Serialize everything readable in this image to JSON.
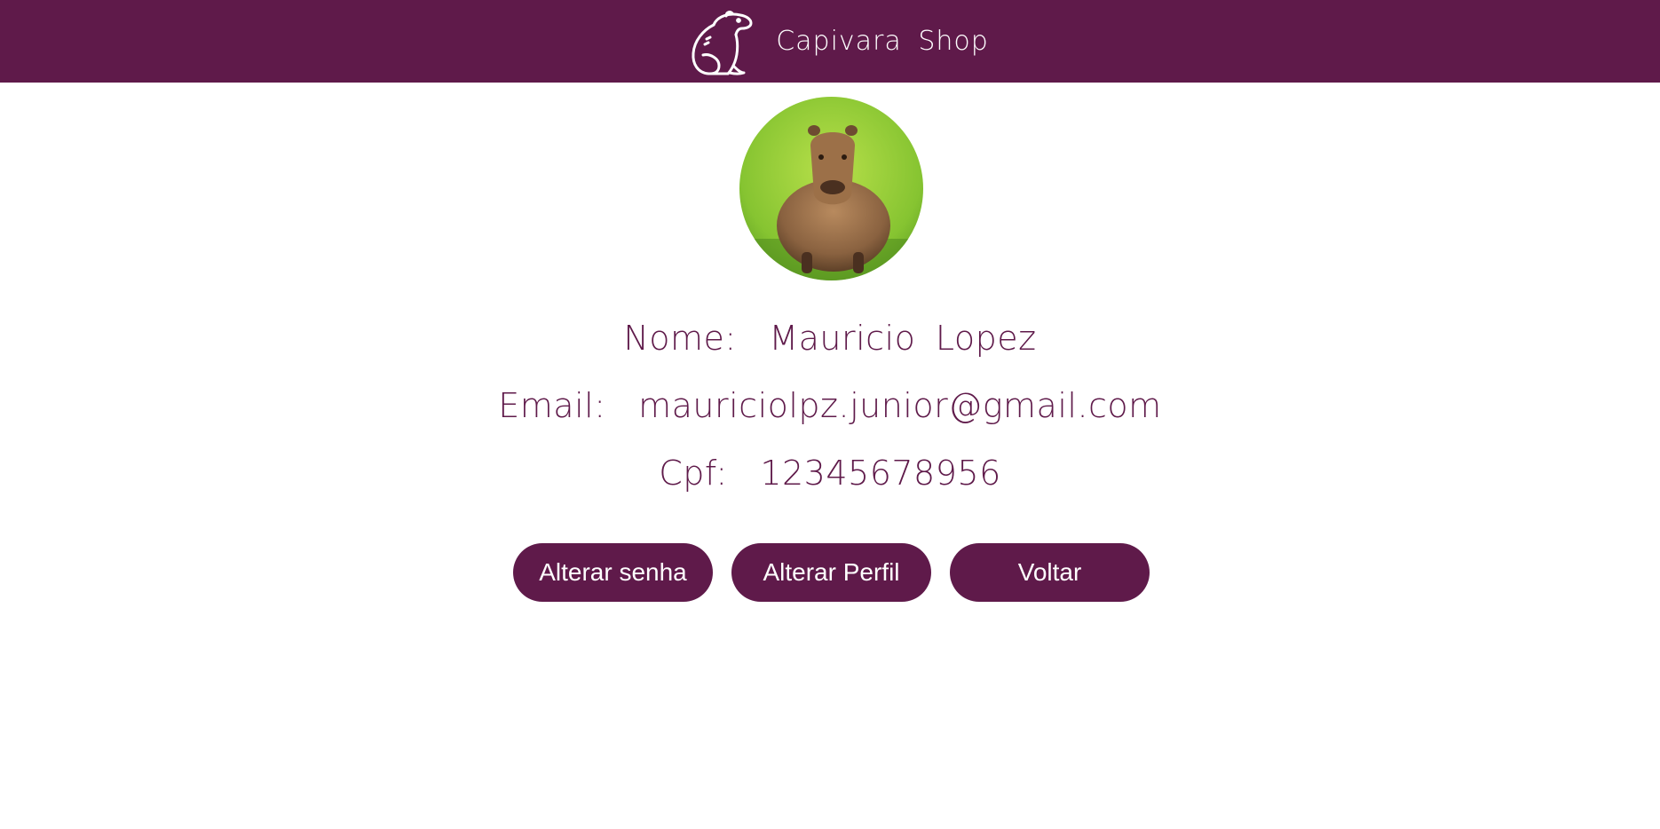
{
  "header": {
    "brand_name": "Capivara Shop",
    "logo_icon": "capybara-outline-icon",
    "background_color": "#5f1a4a"
  },
  "profile": {
    "avatar_icon": "capybara-photo",
    "name_label": "Nome:",
    "name_value": "Mauricio Lopez",
    "email_label": "Email:",
    "email_value": "mauriciolpz.junior@gmail.com",
    "cpf_label": "Cpf:",
    "cpf_value": "12345678956"
  },
  "actions": {
    "change_password": "Alterar senha",
    "edit_profile": "Alterar Perfil",
    "back": "Voltar"
  },
  "colors": {
    "primary": "#5f1a4a",
    "text_on_primary": "#ffffff"
  }
}
